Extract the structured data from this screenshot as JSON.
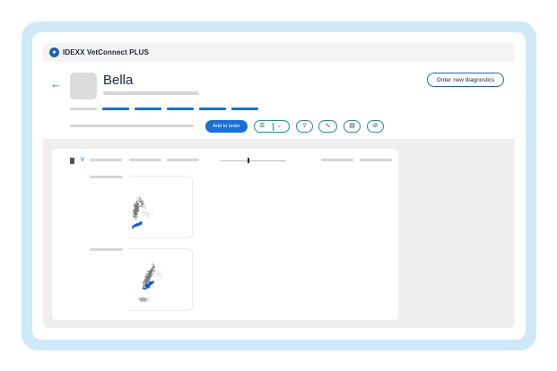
{
  "app": {
    "title": "IDEXX VetConnect PLUS"
  },
  "patient": {
    "name": "Bella"
  },
  "header": {
    "order_label": "Order new diagnostics",
    "add_to_order_label": "Add to order"
  },
  "toolbar": {
    "icons": [
      "list-icon",
      "chevron-down-icon",
      "share-icon",
      "chart-icon",
      "document-icon",
      "compass-icon"
    ]
  },
  "card": {
    "icons": [
      "bookmark-icon",
      "filter-icon",
      "slider"
    ]
  },
  "colors": {
    "accent": "#1b6fd6",
    "outline": "#2c8a85",
    "frame": "#cfe9fb",
    "scatter_primary": "#1a56c8",
    "scatter_secondary": "#7a7a7a"
  }
}
